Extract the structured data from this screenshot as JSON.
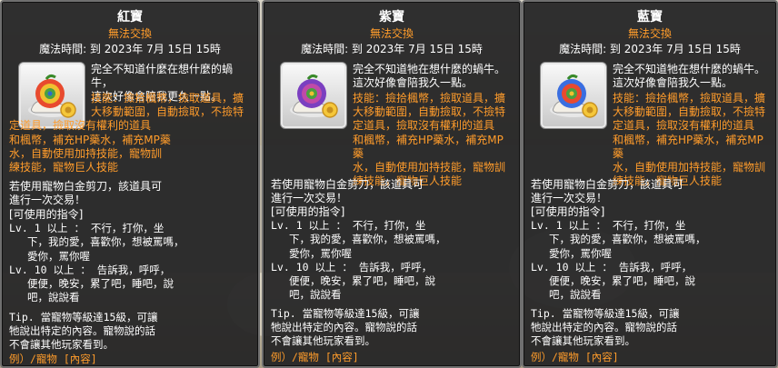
{
  "colors": {
    "panel_bg": "#222224",
    "accent_orange": "#ff9c2b",
    "text": "#ffffff"
  },
  "tooltips": [
    {
      "title": "紅寶",
      "trade_label": "無法交換",
      "expire_label": "魔法時間: 到 2023年 7月 15日 15時",
      "icon": "red-snail-icon",
      "desc_lines": [
        "完全不知道什麼在想什麼的蝸牛，",
        "這次好像會陪我更久一點。"
      ],
      "skill_lines": [
        "技能：撿拾楓幣，撿取道具，擴",
        "大移動範圍，自動撿取，不撿特",
        "定道具，撿取沒有權利的道具",
        "和楓幣，補充HP藥水，補充MP藥",
        "水，自動使用加持技能，寵物訓",
        "練技能，寵物巨人技能"
      ],
      "scissors_lines": [
        "若使用寵物白金剪刀，該道具可",
        "進行一次交易！"
      ],
      "commands_header": "[可使用的指令]",
      "cmd_lines": [
        "Lv. 1 以上 ： 不行，打你，坐",
        "下，我的愛，喜歡你，想被罵嗎，",
        "愛你，罵你喔",
        "Lv. 10 以上 ： 告訴我，呼呼，",
        "便便，晚安，累了吧，睡吧，說",
        "吧，說說看"
      ],
      "tip_lines": [
        "Tip. 當寵物等級達15級，可讓",
        "牠說出特定的內容。寵物說的話",
        "不會讓其他玩家看到。"
      ],
      "example": "例）/寵物 [內容]"
    },
    {
      "title": "紫寶",
      "trade_label": "無法交換",
      "expire_label": "魔法時間: 到 2023年 7月 15日 15時",
      "icon": "purple-snail-icon",
      "desc_lines": [
        "完全不知道牠在想什麼的蝸牛。",
        "這次好像會陪我久一點。"
      ],
      "skill_lines": [
        "技能：撿拾楓幣，撿取道具，擴",
        "大移動範圍，自動撿取，不撿特",
        "定道具，撿取沒有權利的道具",
        "和楓幣，補充HP藥水，補充MP藥",
        "水，自動使用加持技能，寵物訓",
        "練技能，寵物巨人技能"
      ],
      "scissors_lines": [
        "若使用寵物白金剪刀，該道具可",
        "進行一次交易！"
      ],
      "commands_header": "[可使用的指令]",
      "cmd_lines": [
        "Lv. 1 以上 ： 不行，打你，坐",
        "下，我的愛，喜歡你，想被罵嗎，",
        "愛你，罵你喔",
        "Lv. 10 以上 ： 告訴我，呼呼，",
        "便便，晚安，累了吧，睡吧，說",
        "吧，說說看"
      ],
      "tip_lines": [
        "Tip. 當寵物等級達15級，可讓",
        "牠說出特定的內容。寵物說的話",
        "不會讓其他玩家看到。"
      ],
      "example": "例）/寵物 [內容]"
    },
    {
      "title": "藍寶",
      "trade_label": "無法交換",
      "expire_label": "魔法時間: 到 2023年 7月 15日 15時",
      "icon": "blue-snail-icon",
      "desc_lines": [
        "完全不知道牠在想什麼的蝸牛。",
        "這次好像會陪我久一點。"
      ],
      "skill_lines": [
        "技能：撿拾楓幣，撿取道具，擴",
        "大移動範圍，自動撿取，不撿特",
        "定道具，撿取沒有權利的道具",
        "和楓幣，補充HP藥水，補充MP藥",
        "水，自動使用加持技能，寵物訓",
        "練技能，寵物巨人技能"
      ],
      "scissors_lines": [
        "若使用寵物白金剪刀，該道具可",
        "進行一次交易！"
      ],
      "commands_header": "[可使用的指令]",
      "cmd_lines": [
        "Lv. 1 以上 ： 不行，打你，坐",
        "下，我的愛，喜歡你，想被罵嗎，",
        "愛你，罵你喔",
        "Lv. 10 以上 ： 告訴我，呼呼，",
        "便便，晚安，累了吧，睡吧，說",
        "吧，說說看"
      ],
      "tip_lines": [
        "Tip. 當寵物等級達15級，可讓",
        "牠說出特定的內容。寵物說的話",
        "不會讓其他玩家看到。"
      ],
      "example": "例）/寵物 [內容]"
    }
  ]
}
